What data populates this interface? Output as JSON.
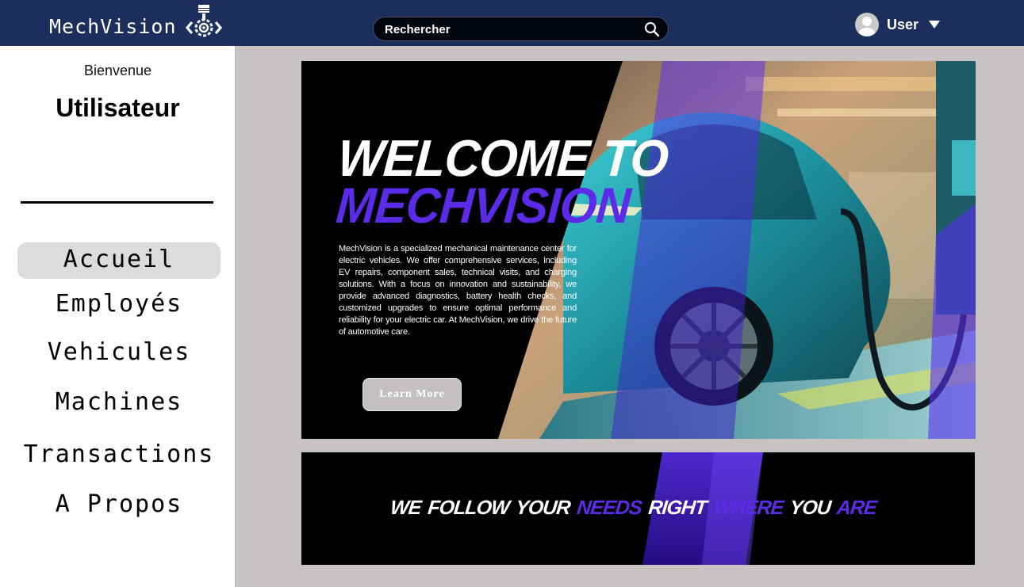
{
  "header": {
    "brand_name": "MechVision",
    "logo_icon": "piston-gear-logo",
    "search_placeholder": "Rechercher",
    "user_label": "User"
  },
  "sidebar": {
    "welcome_text": "Bienvenue",
    "username": "Utilisateur",
    "nav_items": [
      {
        "label": "Accueil",
        "active": true
      },
      {
        "label": "Employés",
        "active": false
      },
      {
        "label": "Vehicules",
        "active": false
      },
      {
        "label": "Machines",
        "active": false
      },
      {
        "label": "Transactions",
        "active": false
      },
      {
        "label": "A Propos",
        "active": false
      }
    ]
  },
  "hero": {
    "title_line1": "WELCOME TO",
    "title_line2": "MECHVISION",
    "description": "MechVision is a specialized mechanical maintenance center for electric vehicles. We offer comprehensive services, including EV repairs, component sales, technical visits, and charging solutions. With a focus on innovation and sustainability, we provide advanced diagnostics, battery health checks, and customized upgrades to ensure optimal performance and reliability for your electric car. At MechVision, we drive the future of automotive care.",
    "button_label": "Learn More",
    "image": "electric-car-charging-photo"
  },
  "banner": {
    "tagline_words": [
      {
        "text": "WE",
        "accent": false
      },
      {
        "text": "FOLLOW",
        "accent": false
      },
      {
        "text": "YOUR",
        "accent": false
      },
      {
        "text": "NEEDS",
        "accent": true
      },
      {
        "text": "RIGHT",
        "accent": false
      },
      {
        "text": "WHERE",
        "accent": true
      },
      {
        "text": "YOU",
        "accent": false
      },
      {
        "text": "ARE",
        "accent": true
      }
    ]
  },
  "colors": {
    "topbar": "#1c2e5b",
    "accent_purple": "#5b2be8",
    "content_bg": "#c8c2c3",
    "active_nav_bg": "#dcdcdc"
  }
}
